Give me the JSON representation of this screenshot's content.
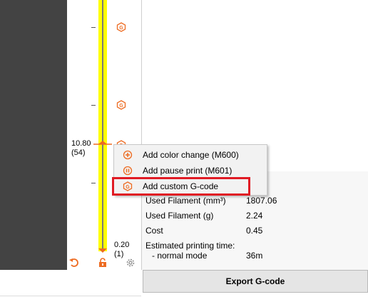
{
  "slider": {
    "upper_value": "10.80",
    "upper_layer": "(54)",
    "lower_value": "0.20",
    "lower_layer": "(1)",
    "marker_icon": "gcode-marker-icon"
  },
  "context_menu": {
    "items": [
      {
        "label": "Add color change (M600)",
        "icon": "plus-circle-icon"
      },
      {
        "label": "Add pause print (M601)",
        "icon": "pause-circle-icon"
      },
      {
        "label": "Add custom G-code",
        "icon": "gcode-icon"
      }
    ]
  },
  "stats": {
    "used_filament_mm_label": "Used Filament (mm³)",
    "used_filament_mm_value": "1807.06",
    "used_filament_g_label": "Used Filament (g)",
    "used_filament_g_value": "2.24",
    "cost_label": "Cost",
    "cost_value": "0.45",
    "time_label": "Estimated printing time:",
    "mode_label": "- normal mode",
    "mode_value": "36m"
  },
  "buttons": {
    "export_label": "Export G-code"
  },
  "colors": {
    "slider_track": "#ffff00",
    "accent": "#ed6b21",
    "highlight": "#e01b24"
  }
}
